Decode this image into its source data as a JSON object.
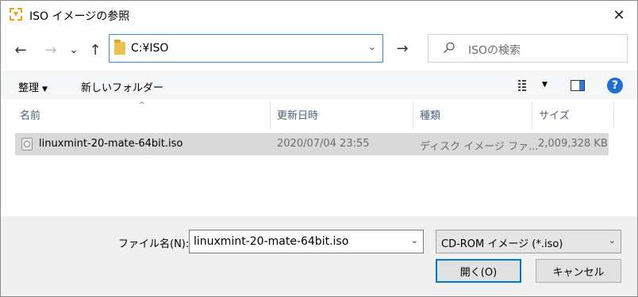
{
  "window": {
    "title": "ISO イメージの参照",
    "close_glyph": "✕",
    "icon": "app-icon"
  },
  "nav": {
    "back_glyph": "←",
    "forward_glyph": "→",
    "recent_glyph": "⌄",
    "up_glyph": "↑",
    "refresh_glyph": "→"
  },
  "address": {
    "path": "C:¥ISO",
    "dropdown_glyph": "⌄"
  },
  "search": {
    "placeholder": "ISOの検索"
  },
  "commands": {
    "organize": "整理",
    "new_folder": "新しいフォルダー",
    "dd_glyph": "▼"
  },
  "columns": {
    "name": "名前",
    "date": "更新日時",
    "type": "種類",
    "size": "サイズ",
    "sort_glyph": "^"
  },
  "files": [
    {
      "name": "linuxmint-20-mate-64bit.iso",
      "date": "2020/07/04 23:55",
      "type": "ディスク イメージ ファ...",
      "size": "2,009,328 KB",
      "selected": true
    }
  ],
  "footer": {
    "filename_label": "ファイル名(N):",
    "filename_value": "linuxmint-20-mate-64bit.iso",
    "filetype_value": "CD-ROM イメージ (*.iso)",
    "open_label": "開く(O)",
    "cancel_label": "キャンセル",
    "dd_glyph": "⌄"
  },
  "colors": {
    "accent": "#0078d7",
    "address_border": "#3c8ddb",
    "selection": "#d9d9d9",
    "help": "#1e6ed4"
  }
}
